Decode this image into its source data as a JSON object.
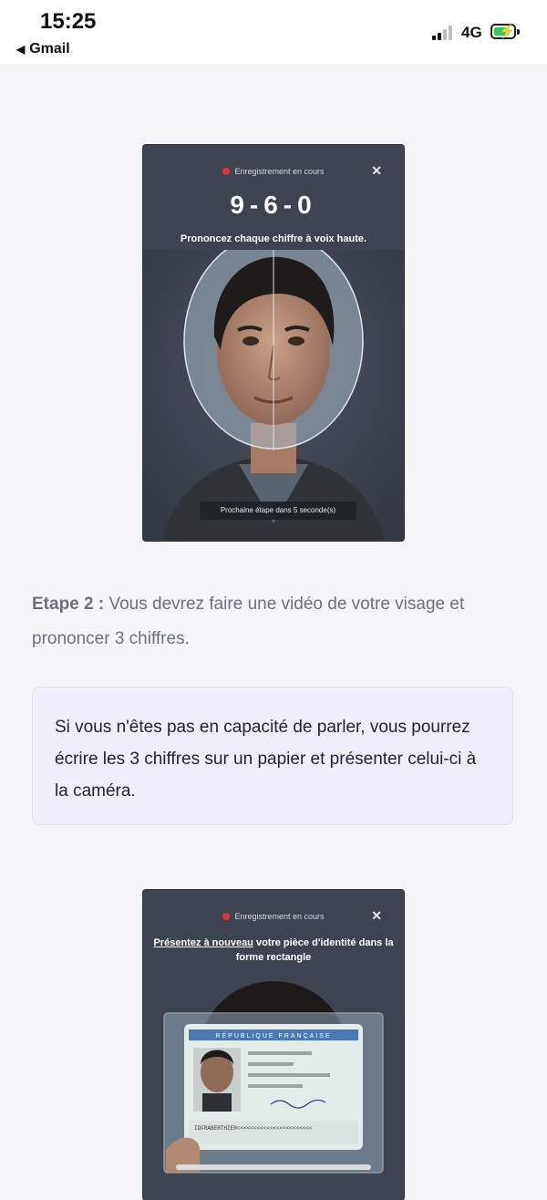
{
  "status_bar": {
    "time": "15:25",
    "back_app": "Gmail",
    "network": "4G",
    "icons": [
      "cell-signal-icon",
      "battery-charging-icon"
    ]
  },
  "mockup_video": {
    "recording_label": "Enregistrement en cours",
    "digits": "9-6-0",
    "instruction": "Prononcez chaque chiffre à voix haute.",
    "footer": "Prochaine étape dans 5 seconde(s)"
  },
  "step2": {
    "label": "Etape 2 :",
    "text": "Vous devrez faire une vidéo de votre visage et prononcer 3 chiffres."
  },
  "note": {
    "text": "Si vous n'êtes pas en capacité de parler, vous pourrez écrire les 3 chiffres sur un papier et présenter celui-ci à la caméra."
  },
  "mockup_id": {
    "recording_label": "Enregistrement en cours",
    "instruction_underlined": "Présentez à nouveau",
    "instruction_rest": " votre pièce d'identité dans la forme rectangle",
    "card_header": "RÉPUBLIQUE FRANÇAISE",
    "card_mrz": "IDFRABERTHIER<<<<<<<<<<<<<<<<<<<<<<<"
  },
  "colors": {
    "record_dot": "#e0323d",
    "mockup_bg": "#3d4450",
    "note_bg": "#eeeffa",
    "battery_green": "#34c759"
  }
}
